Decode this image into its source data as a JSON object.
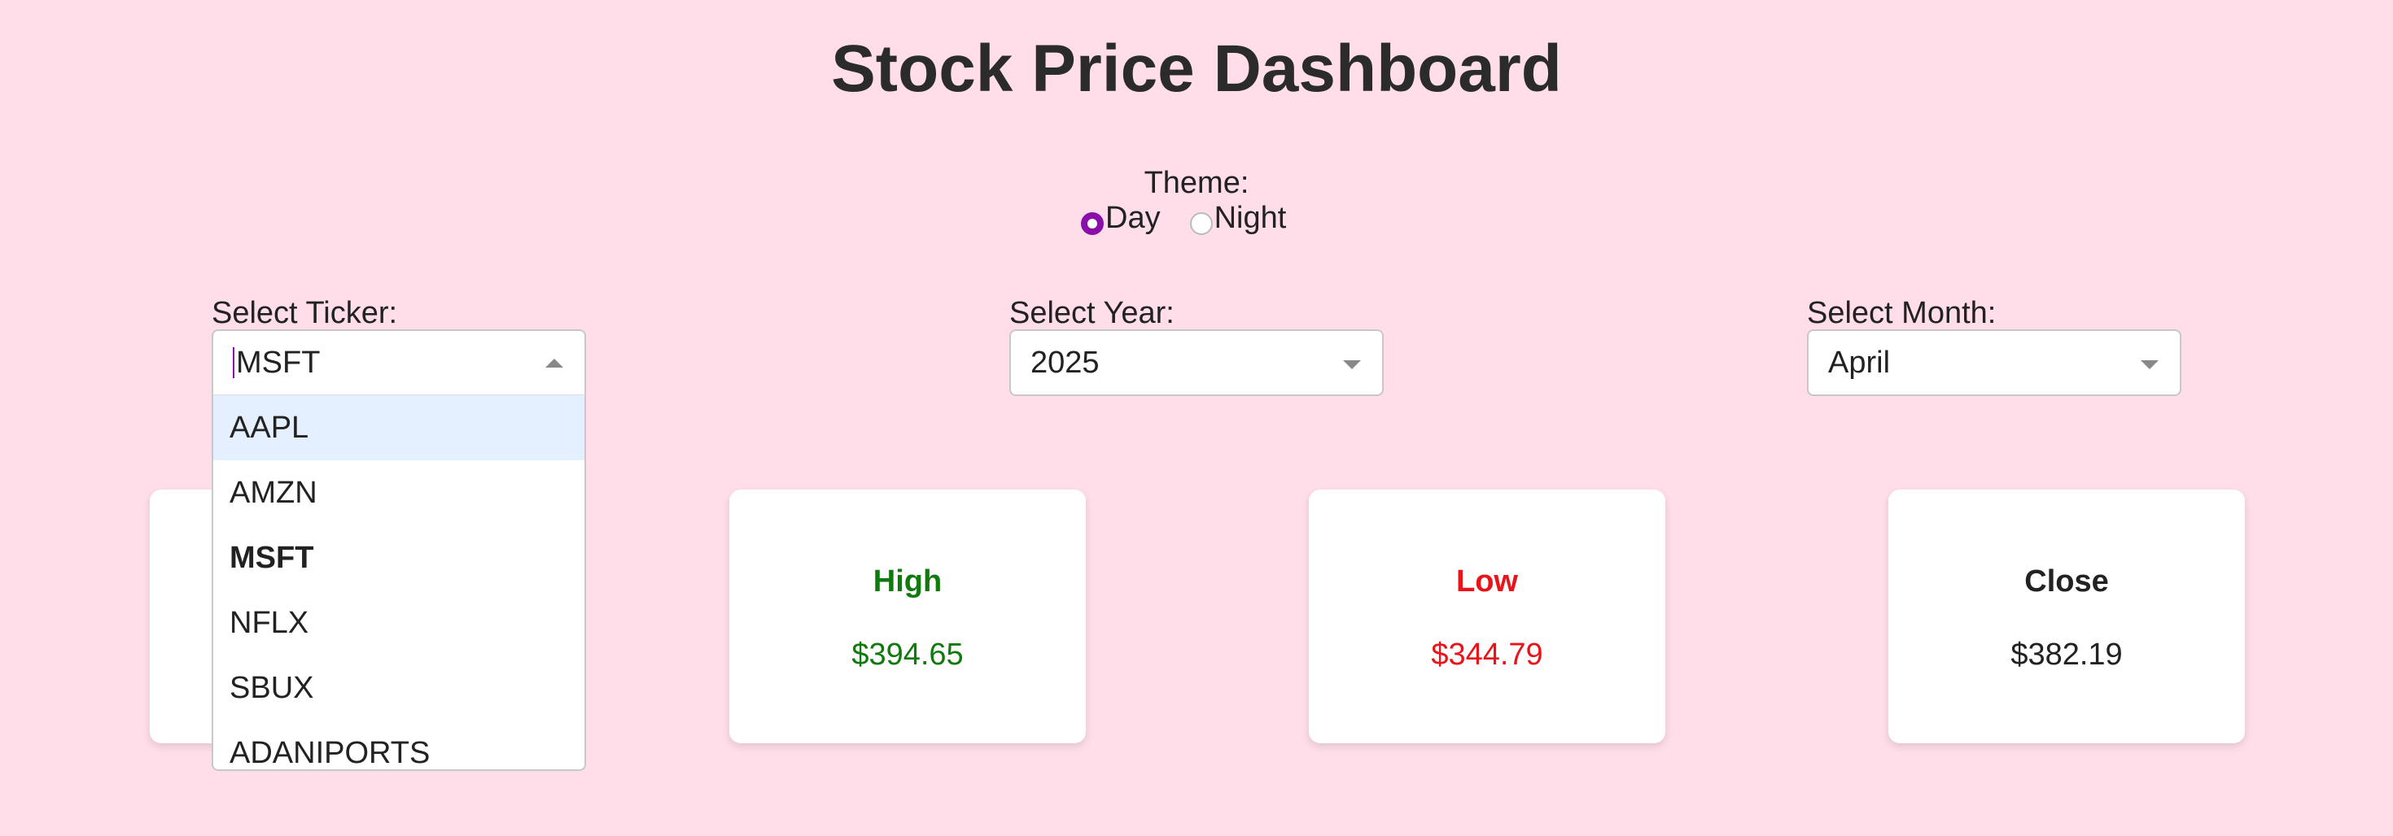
{
  "header": {
    "title": "Stock Price Dashboard"
  },
  "theme": {
    "label": "Theme:",
    "options": [
      {
        "label": "Day",
        "checked": true
      },
      {
        "label": "Night",
        "checked": false
      }
    ]
  },
  "ticker": {
    "label": "Select Ticker:",
    "value": "MSFT",
    "options": [
      "AAPL",
      "AMZN",
      "MSFT",
      "NFLX",
      "SBUX",
      "ADANIPORTS"
    ],
    "highlighted": "AAPL",
    "selected": "MSFT"
  },
  "year": {
    "label": "Select Year:",
    "value": "2025"
  },
  "month": {
    "label": "Select Month:",
    "value": "April"
  },
  "cards": [
    {
      "title": "",
      "value": ""
    },
    {
      "title": "High",
      "value": "$394.65",
      "color": "#117a0f"
    },
    {
      "title": "Low",
      "value": "$344.79",
      "color": "#e8141a"
    },
    {
      "title": "Close",
      "value": "$382.19",
      "color": "#222222"
    }
  ],
  "colors": {
    "background": "#ffdeea",
    "accent": "#8a0fa8"
  }
}
